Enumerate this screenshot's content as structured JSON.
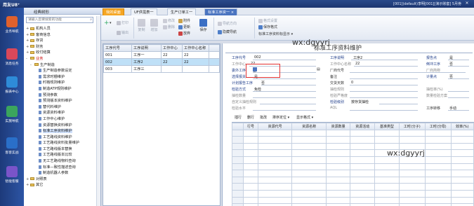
{
  "titlebar": {
    "logo": "用友U8⁺",
    "status": "[001](default)李明[001][演示账套] 5月份"
  },
  "dock": [
    {
      "label": "业务导航",
      "color": "#e0612d",
      "icon": "business-nav-icon"
    },
    {
      "label": "消息任务",
      "color": "#d9485a",
      "icon": "message-task-icon"
    },
    {
      "label": "报表中心",
      "color": "#2e8bd8",
      "icon": "report-center-icon"
    },
    {
      "label": "实施导航",
      "color": "#3ba55d",
      "icon": "implement-nav-icon"
    },
    {
      "label": "客客实战",
      "color": "#2a6fc9",
      "icon": "practice-icon"
    },
    {
      "label": "智能客服",
      "color": "#7a54c9",
      "icon": "smart-service-icon"
    }
  ],
  "nav": {
    "title": "经典树形",
    "search_placeholder": "请输入您要搜索的功能",
    "items": [
      {
        "label": "机构人员",
        "level": 0,
        "kind": "folder",
        "exp": "+"
      },
      {
        "label": "客商信息",
        "level": 0,
        "kind": "folder",
        "exp": "+"
      },
      {
        "label": "存货",
        "level": 0,
        "kind": "folder",
        "exp": "+"
      },
      {
        "label": "财务",
        "level": 0,
        "kind": "folder",
        "exp": "+"
      },
      {
        "label": "收付结算",
        "level": 0,
        "kind": "folder",
        "exp": "+"
      },
      {
        "label": "业务",
        "level": 0,
        "kind": "folder",
        "exp": "-",
        "red": true
      },
      {
        "label": "生产制造",
        "level": 1,
        "kind": "folder",
        "exp": "-"
      },
      {
        "label": "生产制造参数设定",
        "level": 2,
        "kind": "doc"
      },
      {
        "label": "需求时栅维护",
        "level": 2,
        "kind": "doc"
      },
      {
        "label": "时格规则维护",
        "level": 2,
        "kind": "doc"
      },
      {
        "label": "制造ATP规则维护",
        "level": 2,
        "kind": "doc"
      },
      {
        "label": "预测参数",
        "level": 2,
        "kind": "doc"
      },
      {
        "label": "预测版本资料维护",
        "level": 2,
        "kind": "doc"
      },
      {
        "label": "替代料维护",
        "level": 2,
        "kind": "doc"
      },
      {
        "label": "资源资料维护",
        "level": 2,
        "kind": "doc"
      },
      {
        "label": "工作中心维护",
        "level": 2,
        "kind": "doc"
      },
      {
        "label": "资源替换资料维护",
        "level": 2,
        "kind": "doc"
      },
      {
        "label": "标准工序资料维护",
        "level": 2,
        "kind": "doc",
        "selected": true
      },
      {
        "label": "工艺路线资料维护",
        "level": 2,
        "kind": "doc"
      },
      {
        "label": "工艺路线资料批量维护",
        "level": 2,
        "kind": "doc"
      },
      {
        "label": "工艺路线版本替换",
        "level": 2,
        "kind": "doc"
      },
      {
        "label": "工艺路线版本比较",
        "level": 2,
        "kind": "doc"
      },
      {
        "label": "无工艺路线物料查询",
        "level": 2,
        "kind": "doc"
      },
      {
        "label": "标准—致性描述查询",
        "level": 2,
        "kind": "doc"
      },
      {
        "label": "制造机器人参数",
        "level": 2,
        "kind": "doc"
      },
      {
        "label": "对照表",
        "level": 0,
        "kind": "folder",
        "exp": "+"
      },
      {
        "label": "其它",
        "level": 0,
        "kind": "folder",
        "exp": "+"
      }
    ]
  },
  "tabs": [
    {
      "label": "我的桌面",
      "kind": "home"
    },
    {
      "label": "UF供需表一",
      "kind": "normal"
    },
    {
      "label": "生产订单工一",
      "kind": "normal"
    },
    {
      "label": "标准工序资一",
      "kind": "active"
    }
  ],
  "toolbar": {
    "new": "+",
    "new_dd": "▾",
    "print": "打印",
    "output": "输出",
    "copy": "复制",
    "add": "增加",
    "modify": "修改",
    "delete": "删除",
    "attach": "附件",
    "abandon": "放弃",
    "update": "更新",
    "save": "保存",
    "nav_dir": "导航方向",
    "hide_nav": "隐藏导航",
    "format_set": "格式设置",
    "save_format": "保存格式",
    "format_select": "标准工序资料标显示"
  },
  "grid": {
    "headers": [
      "工序代号",
      "工序说明",
      "工作中心",
      "工作中心名称"
    ],
    "rows": [
      [
        "001",
        "工序一",
        "22",
        "22"
      ],
      [
        "002",
        "工序2",
        "22",
        "22"
      ],
      [
        "003",
        "工序三",
        "",
        ""
      ]
    ]
  },
  "form": {
    "title": "标准工序资料维护",
    "fields": {
      "op_code_label": "工序代号",
      "op_code": "002",
      "op_desc_label": "工序说明",
      "op_desc": "工序2",
      "report_point_label": "报告点",
      "report_point": "是",
      "work_center_label": "工作中心",
      "work_center": "22",
      "wc_name_label": "工作中心名称",
      "wc_name": "22",
      "inspect_op_label": "倒冲工序",
      "inspect_op": "否",
      "outsource_label": "委外工序",
      "outsource": "否",
      "factory_code_label": "厂商代号",
      "factory_name_label": "厂商简称",
      "plan_op_label": "选择报关",
      "plan_op": "是",
      "note_label": "备注",
      "count_op_label": "计量点",
      "count_op": "否",
      "plan_no_label": "计划报告工序",
      "plan_no": "否",
      "calc_days_label": "交货天数",
      "calc_days": "0",
      "inspect_method_label": "检验方式",
      "inspect_method": "免检",
      "inspect_rule_label": "抽检规则",
      "inspect_rate_label": "抽检率(%)",
      "sample_count_label": "抽检数量",
      "sample_standard_label": "检验严格度",
      "quantity_tol_label": "数量检验方案",
      "custom_rule_label": "自定义抽检规则",
      "inspect_level_label": "检验级别",
      "sample_by_label": "按存货抽检",
      "sample_level_label": "检验水平",
      "aql_label": "AQL",
      "transfer_label": "工序转移",
      "transfer": "手动"
    }
  },
  "watermark": "wx:dgyyrj",
  "detail": {
    "toolbar": [
      "插行",
      "删行",
      "批改",
      "排序定位 ▾",
      "显示格式 ▾"
    ],
    "headers": [
      "",
      "行号",
      "资源代号",
      "资源名称",
      "资源数量",
      "资源活动",
      "基准类型",
      "工时(分子)",
      "工时(分母)",
      "效率(%)"
    ],
    "row_count": 12
  }
}
